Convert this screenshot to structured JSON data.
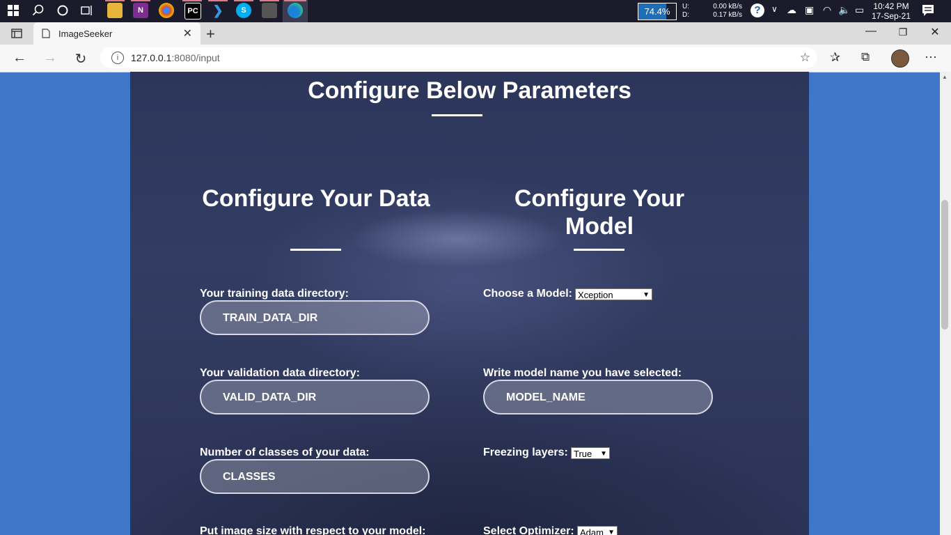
{
  "taskbar": {
    "network_percent": "74.4%",
    "network_fill": 0.744,
    "upload_label": "U:",
    "download_label": "D:",
    "upload_value": "0.00 kB/s",
    "download_value": "0.17 kB/s",
    "time": "10:42 PM",
    "date": "17-Sep-21"
  },
  "browser": {
    "tab_title": "ImageSeeker",
    "url_host": "127.0.0.1",
    "url_rest": ":8080/input"
  },
  "page": {
    "main_title": "Configure Below Parameters",
    "data_title": "Configure Your Data",
    "model_title": "Configure Your Model",
    "data": {
      "train_label": "Your training data directory:",
      "train_placeholder": "TRAIN_DATA_DIR",
      "valid_label": "Your validation data directory:",
      "valid_placeholder": "VALID_DATA_DIR",
      "classes_label": "Number of classes of your data:",
      "classes_placeholder": "CLASSES",
      "image_size_label": "Put image size with respect to your model:"
    },
    "model": {
      "model_label": "Choose a Model:",
      "model_selected": "Xception",
      "model_name_label": "Write model name you have selected:",
      "model_name_placeholder": "MODEL_NAME",
      "freeze_label": "Freezing layers:",
      "freeze_selected": "True",
      "optimizer_label": "Select Optimizer:",
      "optimizer_selected": "Adam"
    }
  }
}
